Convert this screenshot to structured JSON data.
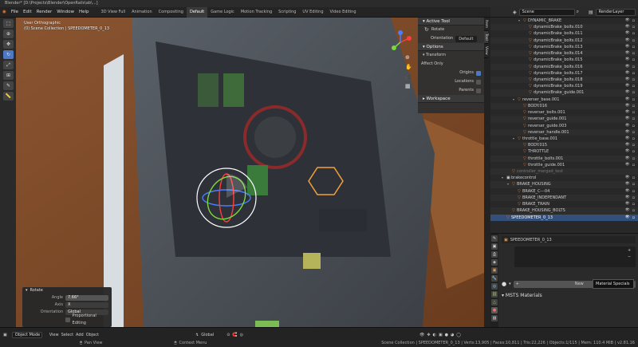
{
  "window": {
    "title": "Blender* [D:\\Projects\\Blender\\OpenRails\\ab\\...]"
  },
  "menu": [
    "File",
    "Edit",
    "Render",
    "Window",
    "Help"
  ],
  "workspaces": [
    "3D View Full",
    "Animation",
    "Compositing",
    "Default",
    "Game Logic",
    "Motion Tracking",
    "Scripting",
    "UV Editing",
    "Video Editing"
  ],
  "active_workspace_index": 3,
  "scene_field": "Scene",
  "view_layer_field": "RenderLayer",
  "viewport": {
    "view_name": "User Orthographic",
    "collection_info": "(0) Scene Collection | SPEEDOMETER_0_13"
  },
  "npanel": {
    "active_tool_header": "Active Tool",
    "tool_name": "Rotate",
    "orientation_label": "Orientation",
    "orientation_value": "Default",
    "options_header": "Options",
    "transform_header": "Transform",
    "affect_only_label": "Affect Only",
    "origins_label": "Origins",
    "locations_label": "Locations",
    "parents_label": "Parents",
    "workspace_header": "Workspace",
    "tabs": [
      "Item",
      "Tool",
      "View"
    ]
  },
  "outliner": {
    "rows": [
      {
        "label": "DYNAMIC_BRAKE",
        "indent": 3,
        "kind": "obj"
      },
      {
        "label": "dynamicBrake_bolts.010",
        "indent": 4,
        "kind": "mesh"
      },
      {
        "label": "dynamicBrake_bolts.011",
        "indent": 4,
        "kind": "mesh"
      },
      {
        "label": "dynamicBrake_bolts.012",
        "indent": 4,
        "kind": "mesh"
      },
      {
        "label": "dynamicBrake_bolts.013",
        "indent": 4,
        "kind": "mesh"
      },
      {
        "label": "dynamicBrake_bolts.014",
        "indent": 4,
        "kind": "mesh"
      },
      {
        "label": "dynamicBrake_bolts.015",
        "indent": 4,
        "kind": "mesh"
      },
      {
        "label": "dynamicBrake_bolts.016",
        "indent": 4,
        "kind": "mesh"
      },
      {
        "label": "dynamicBrake_bolts.017",
        "indent": 4,
        "kind": "mesh"
      },
      {
        "label": "dynamicBrake_bolts.018",
        "indent": 4,
        "kind": "mesh"
      },
      {
        "label": "dynamicBrake_bolts.019",
        "indent": 4,
        "kind": "mesh"
      },
      {
        "label": "dynamicBrake_guide.001",
        "indent": 4,
        "kind": "mesh"
      },
      {
        "label": "reverser_base.001",
        "indent": 2,
        "kind": "obj"
      },
      {
        "label": "BODY.016",
        "indent": 3,
        "kind": "mesh"
      },
      {
        "label": "reverser_bolts.001",
        "indent": 3,
        "kind": "mesh"
      },
      {
        "label": "reverser_guide.001",
        "indent": 3,
        "kind": "mesh"
      },
      {
        "label": "reverser_guide.003",
        "indent": 3,
        "kind": "mesh"
      },
      {
        "label": "reverser_handle.001",
        "indent": 3,
        "kind": "mesh"
      },
      {
        "label": "throttle_base.001",
        "indent": 2,
        "kind": "obj"
      },
      {
        "label": "BODY.015",
        "indent": 3,
        "kind": "mesh"
      },
      {
        "label": "THROTTLE",
        "indent": 3,
        "kind": "mesh"
      },
      {
        "label": "throttle_bolts.001",
        "indent": 3,
        "kind": "mesh"
      },
      {
        "label": "throttle_guide.001",
        "indent": 3,
        "kind": "mesh"
      },
      {
        "label": "controller_merged_test",
        "indent": 1,
        "kind": "dim"
      },
      {
        "label": "brakecontrol",
        "indent": 0,
        "kind": "coll"
      },
      {
        "label": "BRAKE_HOUSING",
        "indent": 1,
        "kind": "obj"
      },
      {
        "label": "BRAKE_C---04",
        "indent": 2,
        "kind": "mesh"
      },
      {
        "label": "BRAKE_INDEPENDANT",
        "indent": 2,
        "kind": "mesh"
      },
      {
        "label": "BRAKE_TRAIN",
        "indent": 2,
        "kind": "mesh"
      },
      {
        "label": "BRAKE_HOUSING_BOLTS",
        "indent": 1,
        "kind": "mesh"
      },
      {
        "label": "SPEEDOMETER_0_13",
        "indent": 0,
        "kind": "sel"
      }
    ]
  },
  "properties": {
    "object_name": "SPEEDOMETER_0_13",
    "new_button": "New",
    "tooltip": "Material Specials",
    "msts_header": "MSTS Materials"
  },
  "operator_panel": {
    "header": "Rotate",
    "angle_label": "Angle",
    "angle_value": "7.66°",
    "axis_label": "Axis",
    "axis_value": "X",
    "orientation_label": "Orientation",
    "orientation_value": "Global",
    "prop_edit_label": "Proportional Editing"
  },
  "header_bottom": {
    "mode": "Object Mode",
    "menus": [
      "View",
      "Select",
      "Add",
      "Object"
    ],
    "transform_orientation": "Global"
  },
  "status_bar": {
    "left": "Pan View",
    "middle": "Context Menu",
    "right": "Scene Collection | SPEEDOMETER_0_13 | Verts:13,905 | Faces:10,811 | Tris:22,226 | Objects:1/115 | Mem: 110.4 MiB | v2.81.16"
  }
}
